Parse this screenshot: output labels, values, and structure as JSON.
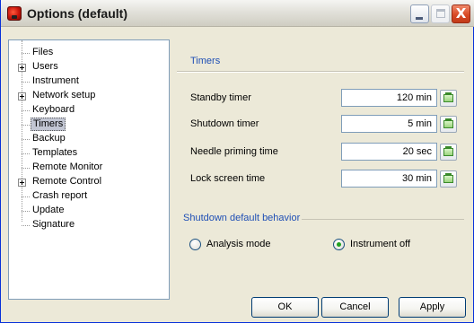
{
  "window": {
    "title": "Options (default)",
    "controls": {
      "minimize": "_",
      "maximize": "□",
      "close": "X"
    }
  },
  "tree": {
    "items": [
      {
        "label": "Files",
        "expandable": false,
        "selected": false
      },
      {
        "label": "Users",
        "expandable": true,
        "selected": false
      },
      {
        "label": "Instrument",
        "expandable": false,
        "selected": false
      },
      {
        "label": "Network setup",
        "expandable": true,
        "selected": false
      },
      {
        "label": "Keyboard",
        "expandable": false,
        "selected": false
      },
      {
        "label": "Timers",
        "expandable": false,
        "selected": true
      },
      {
        "label": "Backup",
        "expandable": false,
        "selected": false
      },
      {
        "label": "Templates",
        "expandable": false,
        "selected": false
      },
      {
        "label": "Remote Monitor",
        "expandable": false,
        "selected": false
      },
      {
        "label": "Remote Control",
        "expandable": true,
        "selected": false
      },
      {
        "label": "Crash report",
        "expandable": false,
        "selected": false
      },
      {
        "label": "Update",
        "expandable": false,
        "selected": false
      },
      {
        "label": "Signature",
        "expandable": false,
        "selected": false
      }
    ]
  },
  "timers": {
    "section_title": "Timers",
    "rows": [
      {
        "label": "Standby timer",
        "value": "120 min"
      },
      {
        "label": "Shutdown timer",
        "value": "5 min"
      },
      {
        "label": "Needle priming time",
        "value": "20 sec"
      },
      {
        "label": "Lock screen time",
        "value": "30 min"
      }
    ]
  },
  "shutdown_behavior": {
    "group_title": "Shutdown default behavior",
    "options": [
      {
        "label": "Analysis mode",
        "checked": false
      },
      {
        "label": "Instrument off",
        "checked": true
      }
    ]
  },
  "buttons": {
    "ok": "OK",
    "cancel": "Cancel",
    "apply": "Apply"
  },
  "colors": {
    "section_title": "#1f4fb5",
    "selection": "#c2c6d3",
    "close_button": "#d94a25"
  }
}
